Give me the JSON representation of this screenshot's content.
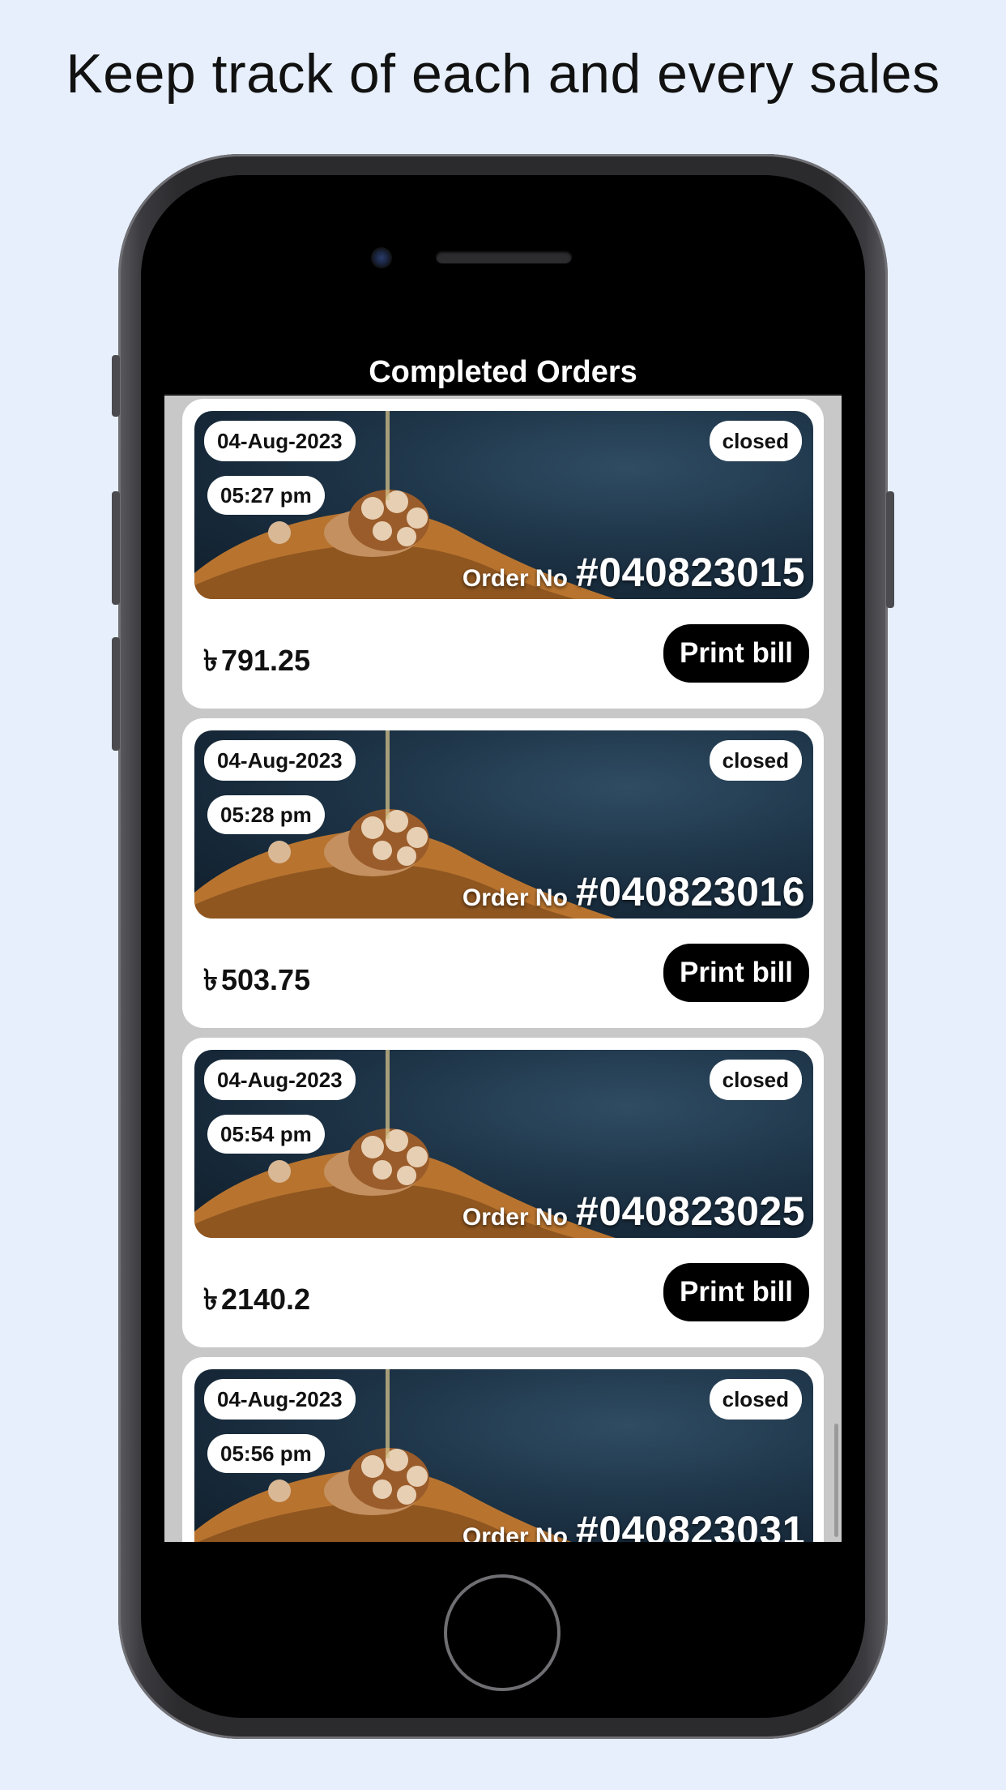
{
  "headline": "Keep track of each and every sales",
  "app": {
    "title": "Completed Orders"
  },
  "labels": {
    "order_no_prefix": "Order No",
    "print_button": "Print bill",
    "currency_symbol": "৳"
  },
  "orders": [
    {
      "date": "04-Aug-2023",
      "time": "05:27 pm",
      "status": "closed",
      "order_no": "#040823015",
      "amount": "791.25"
    },
    {
      "date": "04-Aug-2023",
      "time": "05:28 pm",
      "status": "closed",
      "order_no": "#040823016",
      "amount": "503.75"
    },
    {
      "date": "04-Aug-2023",
      "time": "05:54 pm",
      "status": "closed",
      "order_no": "#040823025",
      "amount": "2140.2"
    },
    {
      "date": "04-Aug-2023",
      "time": "05:56 pm",
      "status": "closed",
      "order_no": "#040823031",
      "amount": ""
    }
  ],
  "colors": {
    "page_background": "#e6effb",
    "app_bar": "#000000",
    "card": "#ffffff",
    "list_background": "#c8c8c8",
    "banner_background": "#1d3346",
    "print_button": "#000000"
  },
  "icons": {
    "banner_image": "walnut-honey-image"
  }
}
